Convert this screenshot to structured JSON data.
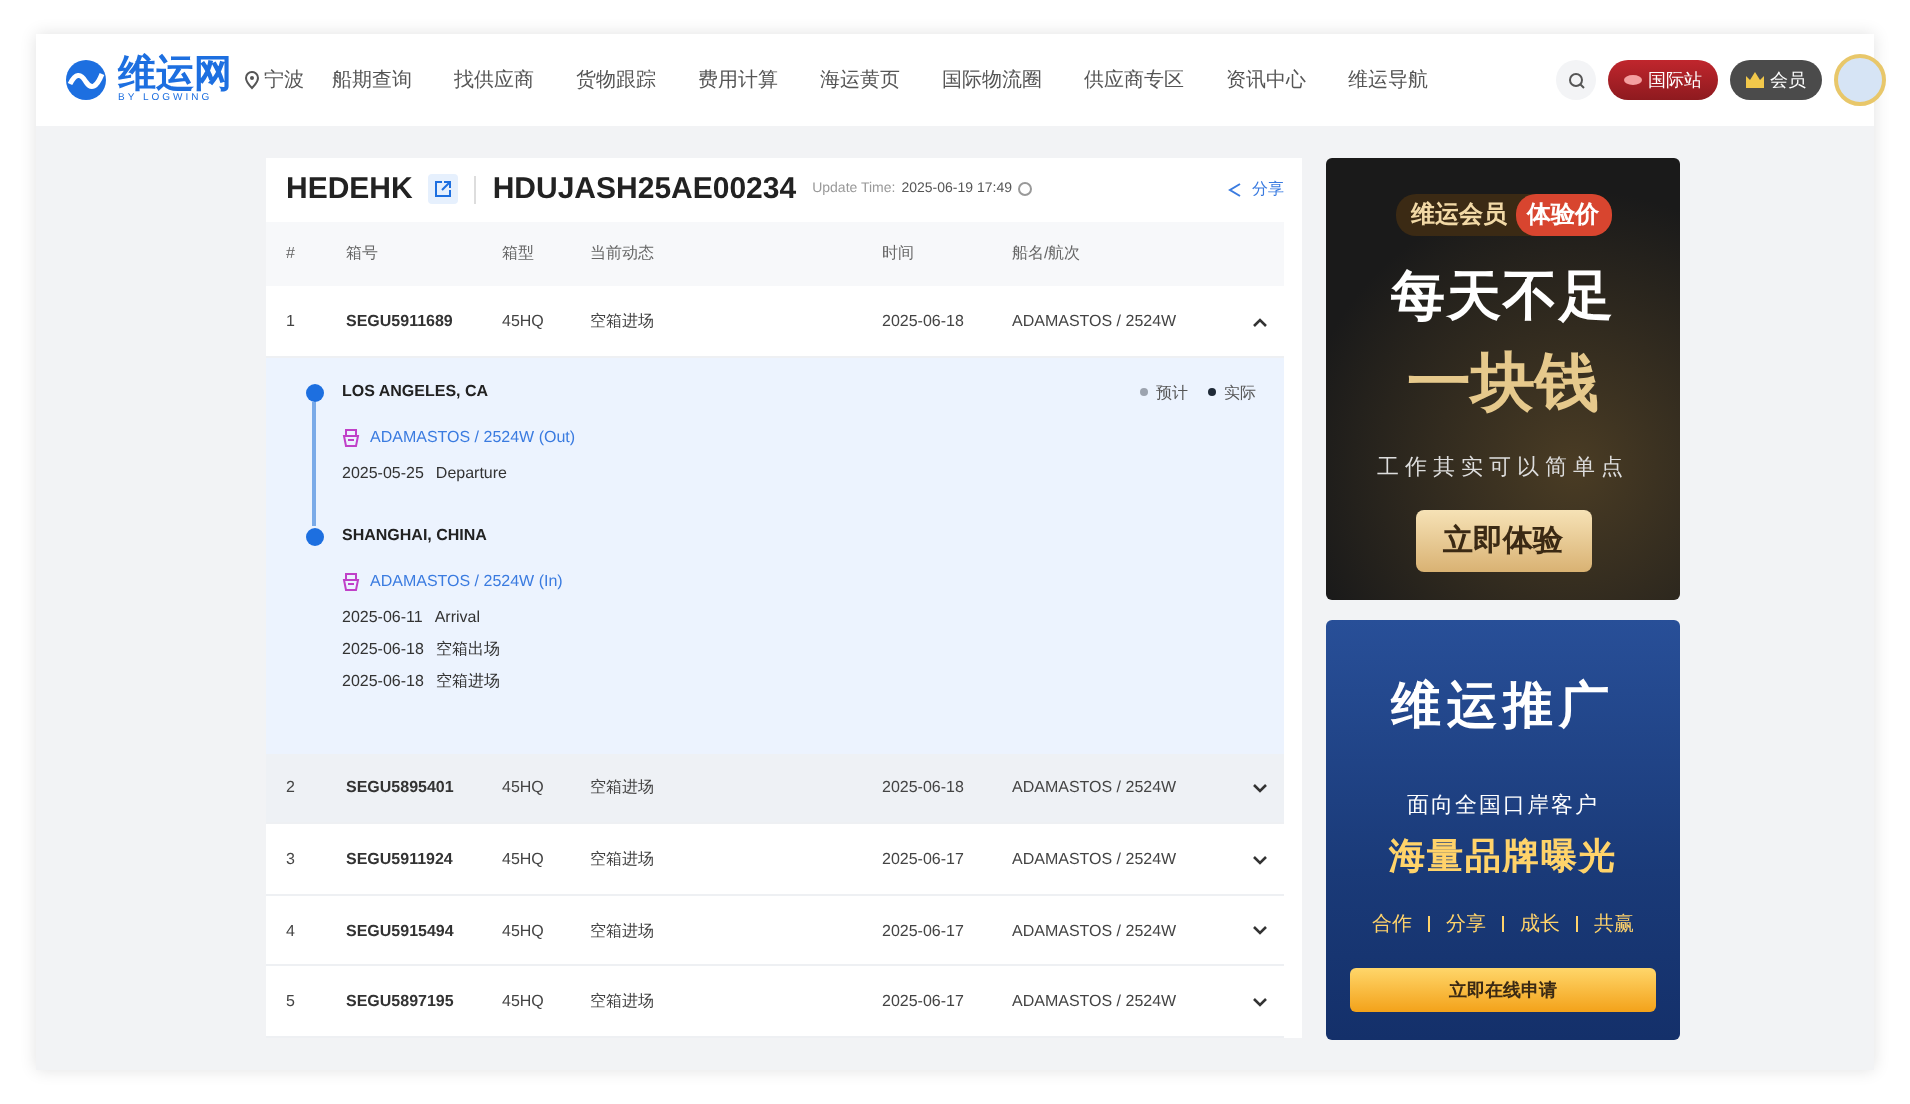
{
  "header": {
    "logo": {
      "name": "维运网",
      "tagline": "BY LOGWING"
    },
    "location": "宁波",
    "nav": [
      "船期查询",
      "找供应商",
      "货物跟踪",
      "费用计算",
      "海运黄页",
      "国际物流圈",
      "供应商专区",
      "资讯中心",
      "维运导航"
    ],
    "intl_button": "国际站",
    "member_button": "会员"
  },
  "tracking": {
    "bl_prefix": "HEDEHK",
    "bl_number": "HDUJASH25AE00234",
    "update_label": "Update Time:",
    "update_time": "2025-06-19 17:49",
    "share": "分享",
    "columns": [
      "#",
      "箱号",
      "箱型",
      "当前动态",
      "时间",
      "船名/航次"
    ],
    "rows": [
      {
        "index": "1",
        "container": "SEGU5911689",
        "type": "45HQ",
        "status": "空箱进场",
        "time": "2025-06-18",
        "vessel": "ADAMASTOS / 2524W",
        "expanded": true,
        "hovered": false
      },
      {
        "index": "2",
        "container": "SEGU5895401",
        "type": "45HQ",
        "status": "空箱进场",
        "time": "2025-06-18",
        "vessel": "ADAMASTOS / 2524W",
        "expanded": false,
        "hovered": true
      },
      {
        "index": "3",
        "container": "SEGU5911924",
        "type": "45HQ",
        "status": "空箱进场",
        "time": "2025-06-17",
        "vessel": "ADAMASTOS / 2524W",
        "expanded": false,
        "hovered": false
      },
      {
        "index": "4",
        "container": "SEGU5915494",
        "type": "45HQ",
        "status": "空箱进场",
        "time": "2025-06-17",
        "vessel": "ADAMASTOS / 2524W",
        "expanded": false,
        "hovered": false
      },
      {
        "index": "5",
        "container": "SEGU5897195",
        "type": "45HQ",
        "status": "空箱进场",
        "time": "2025-06-17",
        "vessel": "ADAMASTOS / 2524W",
        "expanded": false,
        "hovered": false
      }
    ],
    "legend": [
      {
        "label": "预计",
        "color": "#9ca3af"
      },
      {
        "label": "实际",
        "color": "#1f2937"
      }
    ],
    "stops": [
      {
        "place": "LOS ANGELES, CA",
        "vessel": "ADAMASTOS / 2524W (Out)",
        "events": [
          {
            "date": "2025-05-25",
            "text": "Departure"
          }
        ]
      },
      {
        "place": "SHANGHAI, CHINA",
        "vessel": "ADAMASTOS / 2524W (In)",
        "events": [
          {
            "date": "2025-06-11",
            "text": "Arrival"
          },
          {
            "date": "2025-06-18",
            "text": "空箱出场"
          },
          {
            "date": "2025-06-18",
            "text": "空箱进场"
          }
        ]
      }
    ]
  },
  "ads": [
    {
      "kind": "member",
      "badge": "维运会员",
      "badge_tag": "体验价",
      "headline": "每天不足",
      "headline_2": "一块钱",
      "subline": "工作其实可以简单点",
      "cta": "立即体验"
    },
    {
      "kind": "promo",
      "headline": "维运推广",
      "subline": "面向全国口岸客户",
      "headline_2": "海量品牌曝光",
      "tags": [
        "合作",
        "分享",
        "成长",
        "共赢"
      ],
      "cta": "立即在线申请"
    }
  ]
}
